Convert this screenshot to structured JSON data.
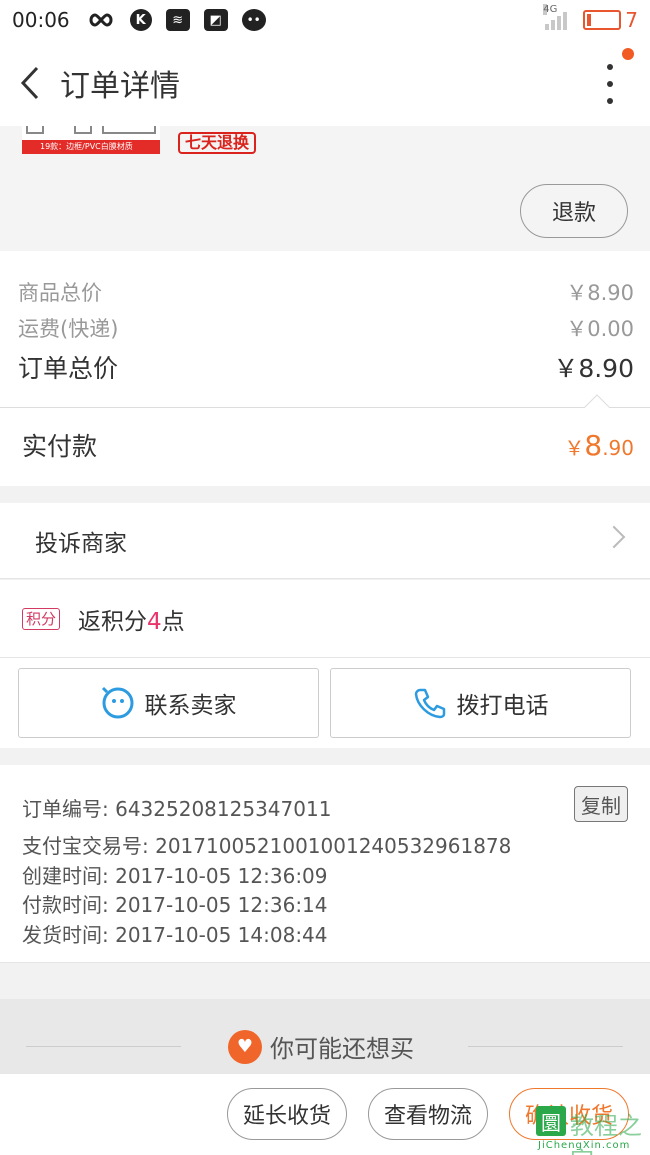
{
  "status_bar": {
    "time": "00:06",
    "network": "4G",
    "battery": "7",
    "icons": [
      "infinity-icon",
      "k-icon",
      "signal-tower-icon",
      "news-icon",
      "wechat-icon"
    ]
  },
  "nav": {
    "title": "订单详情"
  },
  "product": {
    "thumb_caption": "19款：边框/PVC白膜材质",
    "return_tag": "七天退换",
    "refund_label": "退款"
  },
  "price": {
    "goods_total_label": "商品总价",
    "goods_total_value": "￥8.90",
    "shipping_label": "运费(快递)",
    "shipping_value": "￥0.00",
    "order_total_label": "订单总价",
    "order_total_value": "￥8.90",
    "paid_label": "实付款",
    "paid_currency": "￥",
    "paid_int": "8",
    "paid_dec": ".90"
  },
  "complain": {
    "label": "投诉商家"
  },
  "points": {
    "badge": "积分",
    "text_prefix": "返积分",
    "count": "4",
    "text_suffix": "点"
  },
  "actions": {
    "contact_seller": "联系卖家",
    "call_phone": "拨打电话"
  },
  "order_info": {
    "order_no": "订单编号: 64325208125347011",
    "alipay_no": "支付宝交易号: 2017100521001001240532961878",
    "created": "创建时间: 2017-10-05 12:36:09",
    "paid": "付款时间: 2017-10-05 12:36:14",
    "shipped": "发货时间: 2017-10-05 14:08:44",
    "copy_label": "复制"
  },
  "recommend": {
    "title": "你可能还想买"
  },
  "bottom": {
    "extend_label": "延长收货",
    "logistics_label": "查看物流",
    "confirm_label": "确认收货"
  },
  "watermark": {
    "logo_char": "圜",
    "name": "教程之家",
    "domain": "JiChengXin.com"
  },
  "colors": {
    "accent_orange": "#f0782c",
    "notify_orange": "#f25a24",
    "red_tag": "#d9231c",
    "points_pink": "#e8336b",
    "watermark_green": "#2aa84a"
  }
}
